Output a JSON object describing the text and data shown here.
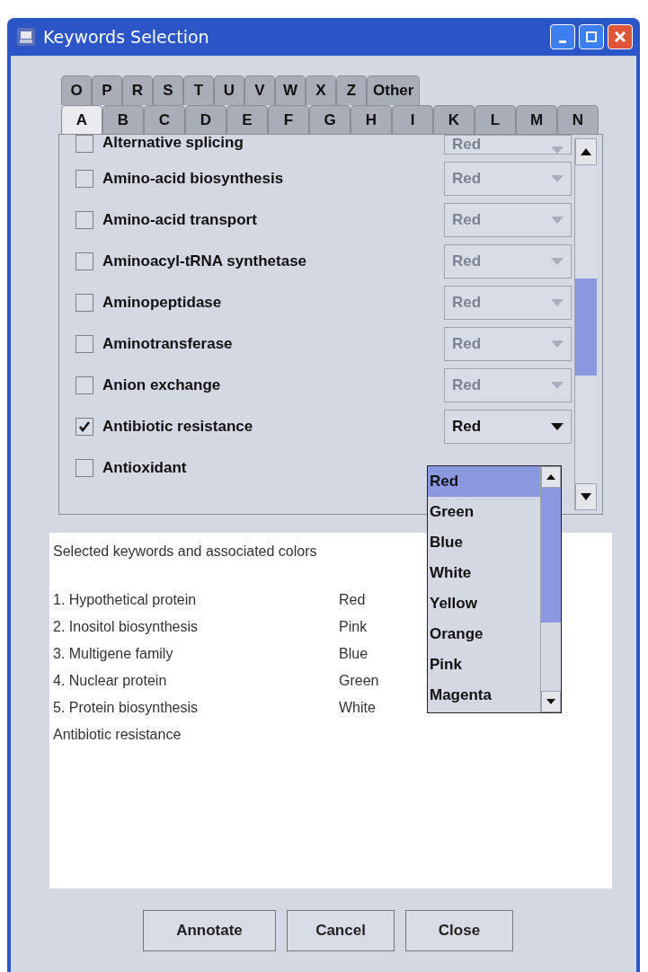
{
  "window": {
    "title": "Keywords Selection"
  },
  "tab_rows": [
    [
      {
        "label": "O",
        "selected": false
      },
      {
        "label": "P",
        "selected": false
      },
      {
        "label": "R",
        "selected": false
      },
      {
        "label": "S",
        "selected": false
      },
      {
        "label": "T",
        "selected": false
      },
      {
        "label": "U",
        "selected": false
      },
      {
        "label": "V",
        "selected": false
      },
      {
        "label": "W",
        "selected": false
      },
      {
        "label": "X",
        "selected": false
      },
      {
        "label": "Z",
        "selected": false
      },
      {
        "label": "Other",
        "selected": false
      }
    ],
    [
      {
        "label": "A",
        "selected": true
      },
      {
        "label": "B",
        "selected": false
      },
      {
        "label": "C",
        "selected": false
      },
      {
        "label": "D",
        "selected": false
      },
      {
        "label": "E",
        "selected": false
      },
      {
        "label": "F",
        "selected": false
      },
      {
        "label": "G",
        "selected": false
      },
      {
        "label": "H",
        "selected": false
      },
      {
        "label": "I",
        "selected": false
      },
      {
        "label": "K",
        "selected": false
      },
      {
        "label": "L",
        "selected": false
      },
      {
        "label": "M",
        "selected": false
      },
      {
        "label": "N",
        "selected": false
      }
    ]
  ],
  "keywords": [
    {
      "label": "Alternative splicing",
      "checked": false,
      "value": "Red"
    },
    {
      "label": "Amino-acid biosynthesis",
      "checked": false,
      "value": "Red"
    },
    {
      "label": "Amino-acid transport",
      "checked": false,
      "value": "Red"
    },
    {
      "label": "Aminoacyl-tRNA synthetase",
      "checked": false,
      "value": "Red"
    },
    {
      "label": "Aminopeptidase",
      "checked": false,
      "value": "Red"
    },
    {
      "label": "Aminotransferase",
      "checked": false,
      "value": "Red"
    },
    {
      "label": "Anion exchange",
      "checked": false,
      "value": "Red"
    },
    {
      "label": "Antibiotic resistance",
      "checked": true,
      "value": "Red"
    },
    {
      "label": "Antioxidant",
      "checked": false
    }
  ],
  "color_popup": {
    "options": [
      {
        "label": "Red",
        "selected": true
      },
      {
        "label": "Green",
        "selected": false
      },
      {
        "label": "Blue",
        "selected": false
      },
      {
        "label": "White",
        "selected": false
      },
      {
        "label": "Yellow",
        "selected": false
      },
      {
        "label": "Orange",
        "selected": false
      },
      {
        "label": "Pink",
        "selected": false
      },
      {
        "label": "Magenta",
        "selected": false
      }
    ]
  },
  "summary": {
    "heading": "Selected keywords and associated colors",
    "items": [
      {
        "keyword": "1. Hypothetical protein",
        "color_name": "Red"
      },
      {
        "keyword": "2. Inositol biosynthesis",
        "color_name": "Pink"
      },
      {
        "keyword": "3. Multigene family",
        "color_name": "Blue"
      },
      {
        "keyword": "4. Nuclear protein",
        "color_name": "Green"
      },
      {
        "keyword": "5. Protein biosynthesis",
        "color_name": "White"
      }
    ],
    "pending": "Antibiotic resistance"
  },
  "buttons": [
    "Annotate",
    "Cancel",
    "Close"
  ]
}
